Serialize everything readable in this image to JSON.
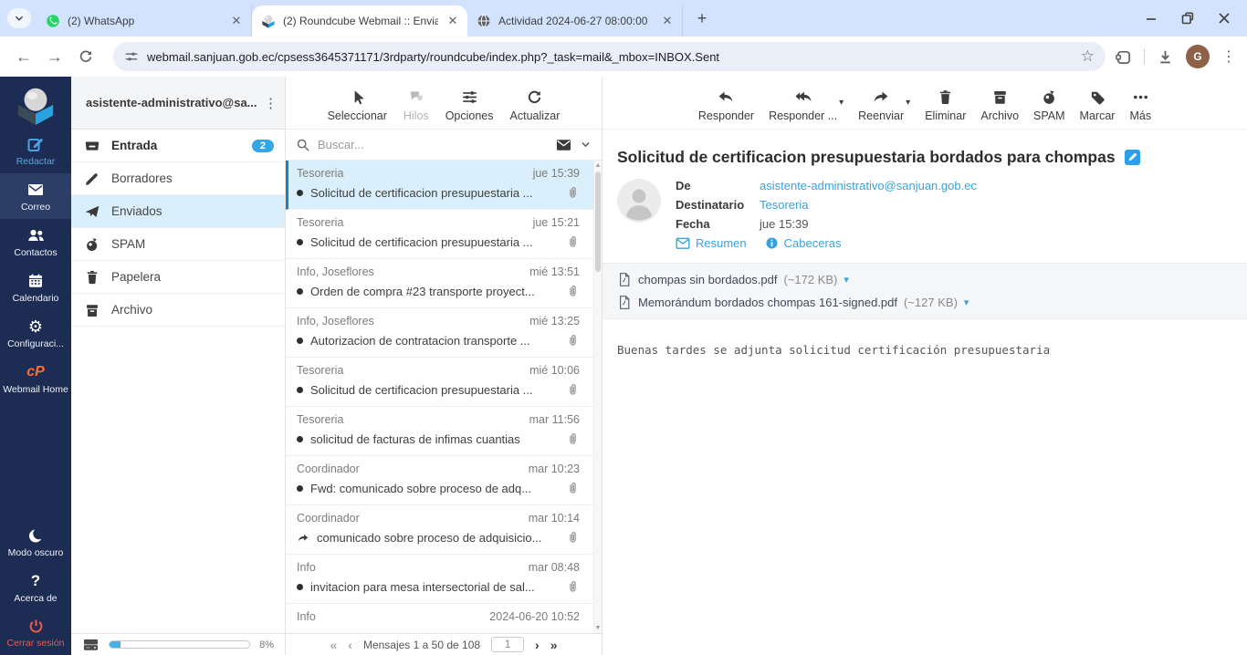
{
  "browser": {
    "tabs": [
      {
        "title": "(2) WhatsApp"
      },
      {
        "title": "(2) Roundcube Webmail :: Envia"
      },
      {
        "title": "Actividad 2024-06-27 08:00:00"
      }
    ],
    "url": "webmail.sanjuan.gob.ec/cpsess3645371171/3rdparty/roundcube/index.php?_task=mail&_mbox=INBOX.Sent",
    "profile_initial": "G"
  },
  "icons": {
    "back": "←",
    "forward": "→",
    "star": "☆",
    "kebab": "⋮",
    "gear": "⚙",
    "question": "?",
    "caret_down": "▾",
    "plus": "+",
    "first": "«",
    "prev": "‹",
    "next": "›",
    "last": "»"
  },
  "colors": {
    "accent_blue": "#37a3dd",
    "sidebar_navy": "#1d2c52",
    "selection_blue": "#d9effb",
    "danger_red": "#f2564f",
    "cpanel_orange": "#ff6c2c",
    "badge_blue": "#35a5e5"
  },
  "sidebar": {
    "items": [
      {
        "label": "Redactar"
      },
      {
        "label": "Correo"
      },
      {
        "label": "Contactos"
      },
      {
        "label": "Calendario"
      },
      {
        "label": "Configuraci..."
      },
      {
        "label": "Webmail Home"
      },
      {
        "label": "Modo oscuro"
      },
      {
        "label": "Acerca de"
      },
      {
        "label": "Cerrar sesión"
      }
    ]
  },
  "folders": {
    "account": "asistente-administrativo@sa...",
    "items": [
      {
        "label": "Entrada",
        "badge": "2"
      },
      {
        "label": "Borradores"
      },
      {
        "label": "Enviados"
      },
      {
        "label": "SPAM"
      },
      {
        "label": "Papelera"
      },
      {
        "label": "Archivo"
      }
    ],
    "quota": "8%"
  },
  "list": {
    "toolbar": [
      {
        "label": "Seleccionar"
      },
      {
        "label": "Hilos"
      },
      {
        "label": "Opciones"
      },
      {
        "label": "Actualizar"
      }
    ],
    "search_placeholder": "Buscar...",
    "messages": [
      {
        "sender": "Tesoreria",
        "date": "jue 15:39",
        "subject": "Solicitud de certificacion presupuestaria ..."
      },
      {
        "sender": "Tesoreria",
        "date": "jue 15:21",
        "subject": "Solicitud de certificacion presupuestaria ..."
      },
      {
        "sender": "Info, Joseflores",
        "date": "mié 13:51",
        "subject": "Orden de compra #23 transporte proyect..."
      },
      {
        "sender": "Info, Joseflores",
        "date": "mié 13:25",
        "subject": "Autorizacion de contratacion transporte ..."
      },
      {
        "sender": "Tesoreria",
        "date": "mié 10:06",
        "subject": "Solicitud de certificacion presupuestaria ..."
      },
      {
        "sender": "Tesoreria",
        "date": "mar 11:56",
        "subject": "solicitud de facturas de infimas cuantias"
      },
      {
        "sender": "Coordinador",
        "date": "mar 10:23",
        "subject": "Fwd: comunicado sobre proceso de adq..."
      },
      {
        "sender": "Coordinador",
        "date": "mar 10:14",
        "subject": "comunicado sobre proceso de adquisicio..."
      },
      {
        "sender": "Info",
        "date": "mar 08:48",
        "subject": "invitacion para mesa intersectorial de sal..."
      },
      {
        "sender": "Info",
        "date": "2024-06-20 10:52",
        "subject": ""
      }
    ],
    "footer": {
      "range": "Mensajes 1 a 50 de 108",
      "page": "1"
    }
  },
  "message": {
    "toolbar": [
      {
        "label": "Responder"
      },
      {
        "label": "Responder ..."
      },
      {
        "label": "Reenviar"
      },
      {
        "label": "Eliminar"
      },
      {
        "label": "Archivo"
      },
      {
        "label": "SPAM"
      },
      {
        "label": "Marcar"
      },
      {
        "label": "Más"
      }
    ],
    "subject": "Solicitud de certificacion presupuestaria bordados para chompas",
    "from_label": "De",
    "from": "asistente-administrativo@sanjuan.gob.ec",
    "to_label": "Destinatario",
    "to": "Tesoreria",
    "date_label": "Fecha",
    "date": "jue 15:39",
    "summary_link": "Resumen",
    "headers_link": "Cabeceras",
    "attachments": [
      {
        "name": "chompas sin bordados.pdf",
        "size": "(~172 KB)"
      },
      {
        "name": "Memorándum bordados chompas 161-signed.pdf",
        "size": "(~127 KB)"
      }
    ],
    "body": "Buenas tardes se adjunta solicitud certificación presupuestaria"
  }
}
